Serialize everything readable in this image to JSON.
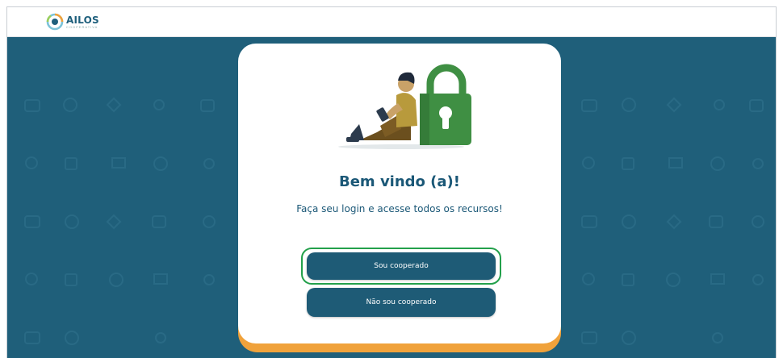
{
  "header": {
    "logo_text": "AILOS",
    "logo_subtext": "COOPERATIVA",
    "logo_icon": "ailos-logo-icon"
  },
  "card": {
    "illustration": "person-with-padlock-illustration",
    "title": "Bem vindo (a)!",
    "subtitle": "Faça seu login e acesse todos os recursos!",
    "buttons": {
      "cooperado": "Sou cooperado",
      "nao_cooperado": "Não sou cooperado"
    }
  },
  "colors": {
    "background": "#1f5f7a",
    "card": "#ffffff",
    "accent_orange": "#f0a23b",
    "button": "#1e5b76",
    "highlight": "#23a04b",
    "text": "#1b5877",
    "padlock": "#3f8f43"
  }
}
